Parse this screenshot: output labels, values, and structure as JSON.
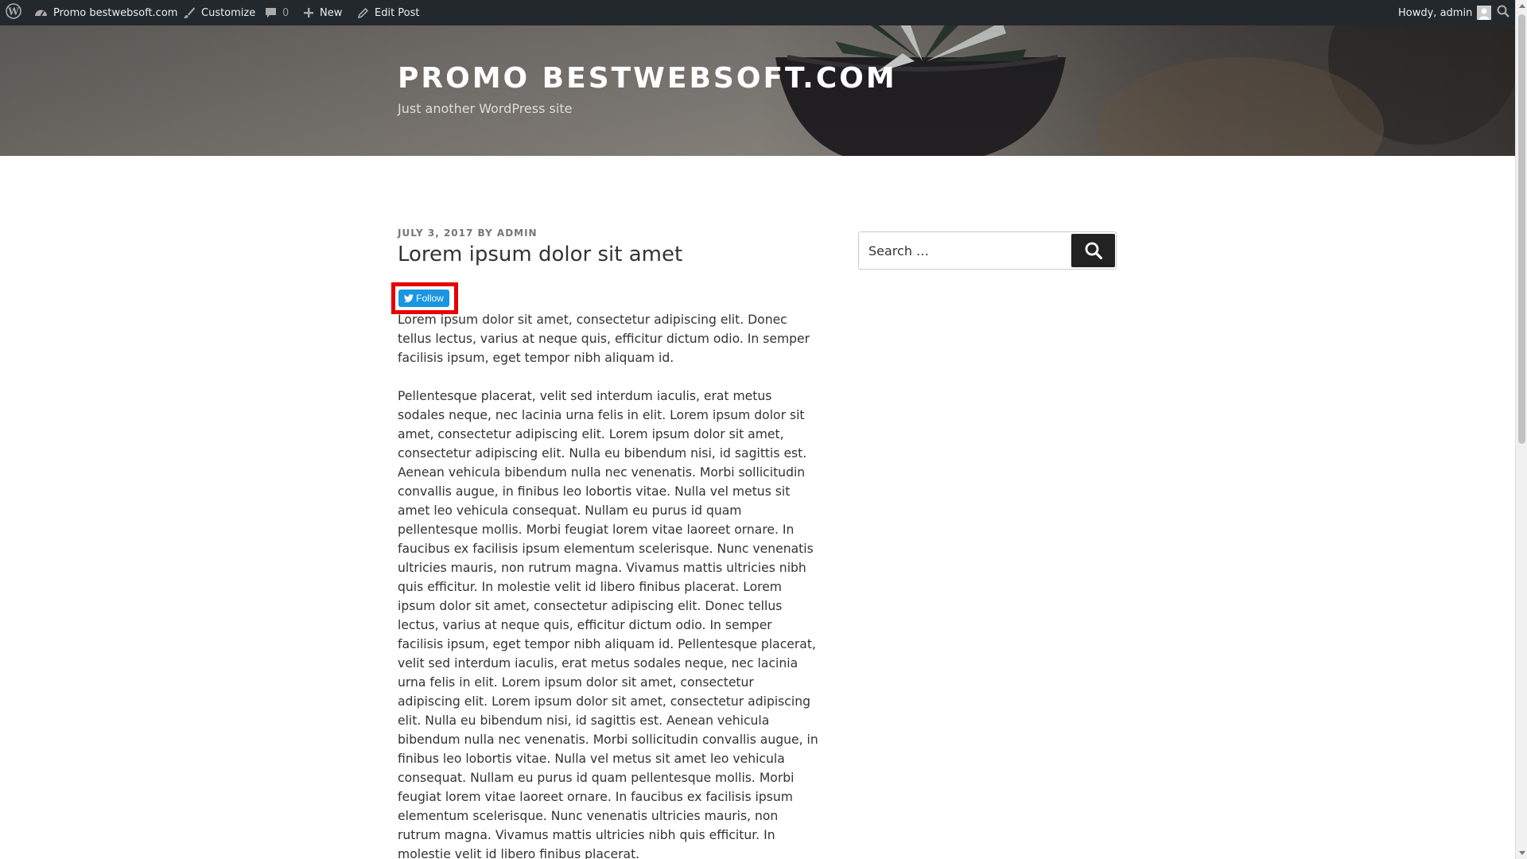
{
  "adminbar": {
    "wp_icon": "wordpress-icon",
    "site_name": "Promo bestwebsoft.com",
    "site_icon": "dashboard-icon",
    "customize_label": "Customize",
    "customize_icon": "brush-icon",
    "comments_icon": "comment-icon",
    "comments_count": "0",
    "new_label": "New",
    "new_icon": "plus-icon",
    "edit_label": "Edit Post",
    "edit_icon": "pencil-icon",
    "howdy": "Howdy, admin",
    "avatar_icon": "avatar-icon",
    "search_icon": "search-icon"
  },
  "header": {
    "site_title": "PROMO BESTWEBSOFT.COM",
    "site_description": "Just another WordPress site"
  },
  "post": {
    "date": "JULY 3, 2017",
    "by": "BY",
    "author": "ADMIN",
    "title": "Lorem ipsum dolor sit amet",
    "follow_label": "Follow",
    "follow_icon": "twitter-bird-icon",
    "paragraphs": [
      "Lorem ipsum dolor sit amet, consectetur adipiscing elit. Donec tellus lectus, varius at neque quis, efficitur dictum odio. In semper facilisis ipsum, eget tempor nibh aliquam id.",
      "Pellentesque placerat, velit sed interdum iaculis, erat metus sodales neque, nec lacinia urna felis in elit. Lorem ipsum dolor sit amet, consectetur adipiscing elit. Lorem ipsum dolor sit amet, consectetur adipiscing elit. Nulla eu bibendum nisi, id sagittis est. Aenean vehicula bibendum nulla nec venenatis. Morbi sollicitudin convallis augue, in finibus leo lobortis vitae. Nulla vel metus sit amet leo vehicula consequat. Nullam eu purus id quam pellentesque mollis. Morbi feugiat lorem vitae laoreet ornare. In faucibus ex facilisis ipsum elementum scelerisque. Nunc venenatis ultricies mauris, non rutrum magna. Vivamus mattis ultricies nibh quis efficitur. In molestie velit id libero finibus placerat. Lorem ipsum dolor sit amet, consectetur adipiscing elit. Donec tellus lectus, varius at neque quis, efficitur dictum odio. In semper facilisis ipsum, eget tempor nibh aliquam id. Pellentesque placerat, velit sed interdum iaculis, erat metus sodales neque, nec lacinia urna felis in elit. Lorem ipsum dolor sit amet, consectetur adipiscing elit. Lorem ipsum dolor sit amet, consectetur adipiscing elit. Nulla eu bibendum nisi, id sagittis est. Aenean vehicula bibendum nulla nec venenatis. Morbi sollicitudin convallis augue, in finibus leo lobortis vitae. Nulla vel metus sit amet leo vehicula consequat. Nullam eu purus id quam pellentesque mollis. Morbi feugiat lorem vitae laoreet ornare. In faucibus ex facilisis ipsum elementum scelerisque. Nunc venenatis ultricies mauris, non rutrum magna. Vivamus mattis ultricies nibh quis efficitur. In molestie velit id libero finibus placerat."
    ]
  },
  "sidebar": {
    "search_placeholder": "Search …",
    "search_icon": "search-icon"
  },
  "colors": {
    "adminbar_bg": "#23282d",
    "follow_button": "#1b95e0",
    "highlight": "#e60000",
    "search_button": "#222222"
  }
}
